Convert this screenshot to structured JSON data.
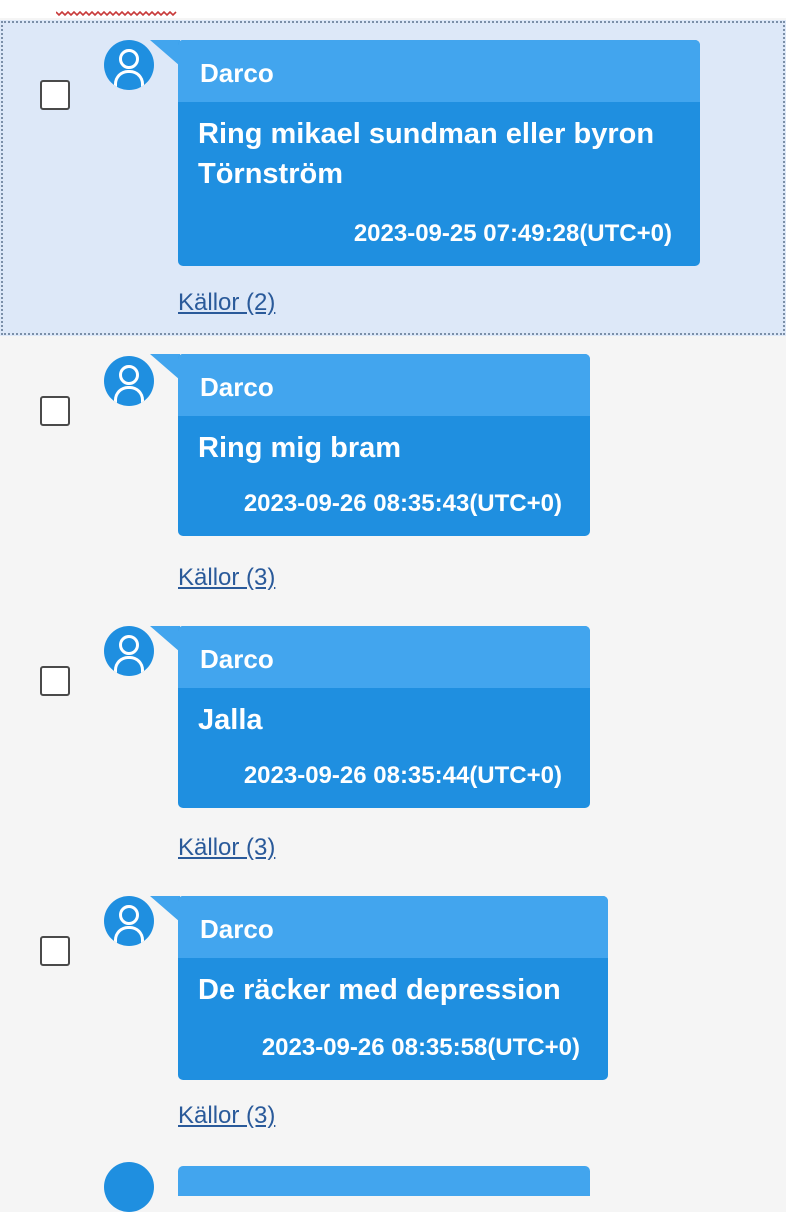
{
  "messages": [
    {
      "sender": "Darco",
      "text": "Ring mikael sundman eller byron Törnström",
      "timestamp": "2023-09-25 07:49:28(UTC+0)",
      "sources": "Källor (2)",
      "selected": true
    },
    {
      "sender": "Darco",
      "text": "Ring mig bram",
      "timestamp": "2023-09-26 08:35:43(UTC+0)",
      "sources": "Källor (3)",
      "selected": false
    },
    {
      "sender": "Darco",
      "text": "Jalla",
      "timestamp": "2023-09-26 08:35:44(UTC+0)",
      "sources": "Källor (3)",
      "selected": false
    },
    {
      "sender": "Darco",
      "text": "De räcker med depression",
      "timestamp": "2023-09-26 08:35:58(UTC+0)",
      "sources": "Källor (3)",
      "selected": false
    }
  ],
  "icons": {
    "avatar": "user-avatar-icon",
    "checkbox": "checkbox-unchecked"
  },
  "colors": {
    "bubble": "#1f8fe0",
    "bubble_header": "#42a5ee",
    "selection_bg": "#dde8f8",
    "link": "#2a5a9a"
  }
}
